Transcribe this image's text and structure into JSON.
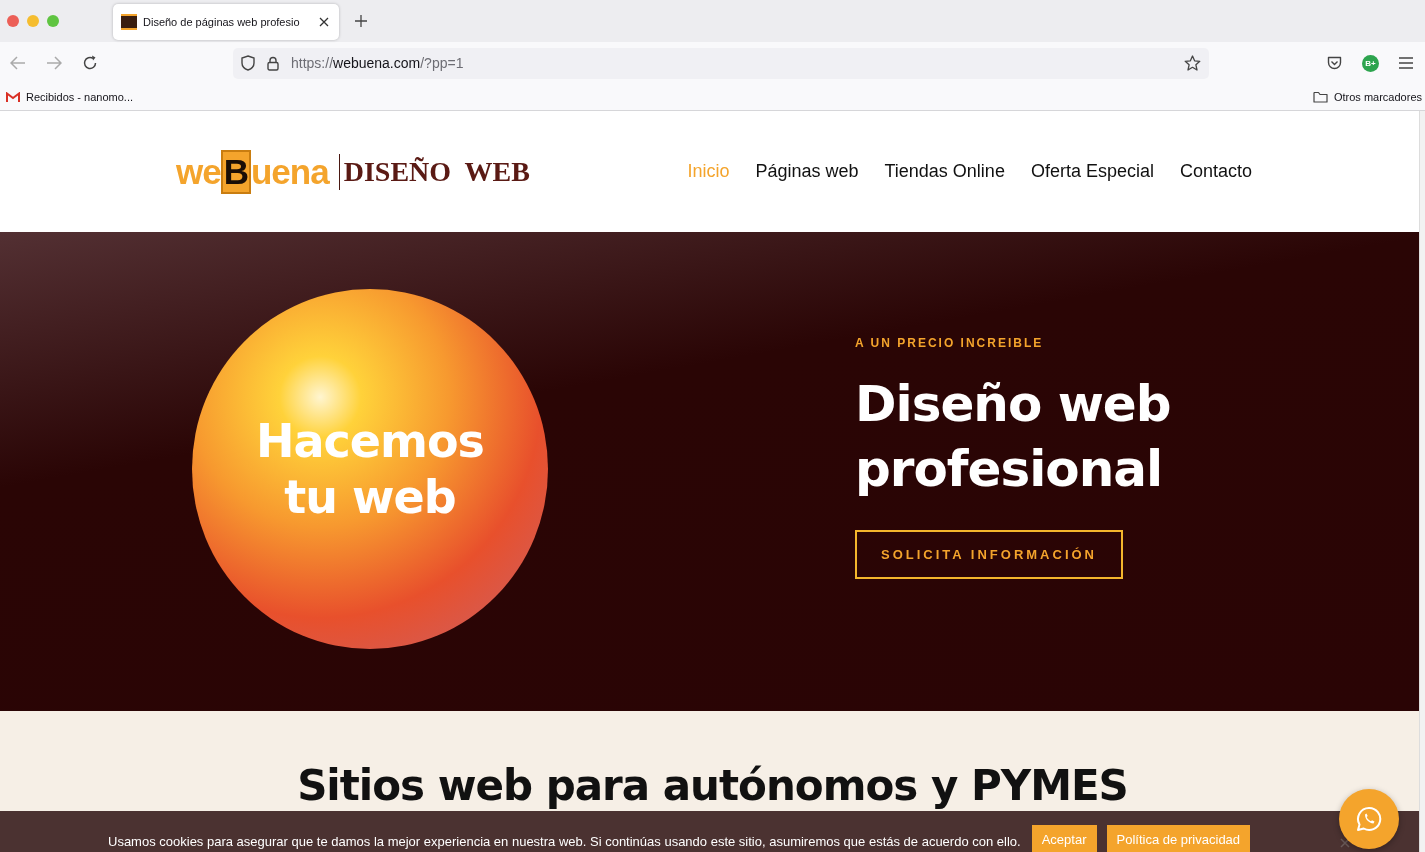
{
  "browser": {
    "tabs": [
      {
        "title": "Diseño de páginas web profesio",
        "selected": true
      }
    ],
    "url": {
      "scheme": "https://",
      "host": "webuena.com",
      "path": "/?pp=1"
    },
    "profile_badge": "B+",
    "bookmarks": [
      {
        "label": "Recibidos - nanomo..."
      }
    ],
    "other_bookmarks": "Otros marcadores"
  },
  "site": {
    "logo": {
      "prefix": "we",
      "letter": "B",
      "suffix": "uena",
      "tagline": "DISEÑO  WEB"
    },
    "nav": [
      {
        "label": "Inicio",
        "selected": true
      },
      {
        "label": "Páginas web",
        "selected": false
      },
      {
        "label": "Tiendas Online",
        "selected": false
      },
      {
        "label": "Oferta Especial",
        "selected": false
      },
      {
        "label": "Contacto",
        "selected": false
      }
    ],
    "hero": {
      "sphere_text": [
        "Hacemos",
        "tu web"
      ],
      "eyebrow": "A UN PRECIO INCREIBLE",
      "title": [
        "Diseño web",
        "profesional"
      ],
      "button": "SOLICITA INFORMACIÓN"
    },
    "section_title": "Sitios web para autónomos y PYMES",
    "cookie_bar": {
      "message": "Usamos cookies para asegurar que te damos la mejor experiencia en nuestra web. Si continúas usando este sitio, asumiremos que estás de acuerdo con ello.",
      "buttons": [
        "Aceptar",
        "Política de privacidad"
      ]
    }
  }
}
